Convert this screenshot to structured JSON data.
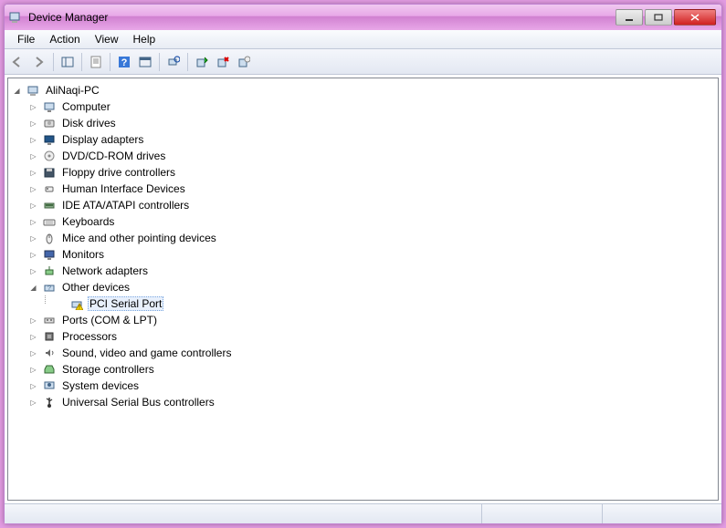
{
  "title": "Device Manager",
  "menu": {
    "file": "File",
    "action": "Action",
    "view": "View",
    "help": "Help"
  },
  "tree": {
    "root": "AliNaqi-PC",
    "items": [
      {
        "label": "Computer",
        "icon": "computer",
        "expanded": false
      },
      {
        "label": "Disk drives",
        "icon": "disk",
        "expanded": false
      },
      {
        "label": "Display adapters",
        "icon": "display",
        "expanded": false
      },
      {
        "label": "DVD/CD-ROM drives",
        "icon": "dvd",
        "expanded": false
      },
      {
        "label": "Floppy drive controllers",
        "icon": "floppy",
        "expanded": false
      },
      {
        "label": "Human Interface Devices",
        "icon": "hid",
        "expanded": false
      },
      {
        "label": "IDE ATA/ATAPI controllers",
        "icon": "ide",
        "expanded": false
      },
      {
        "label": "Keyboards",
        "icon": "keyboard",
        "expanded": false
      },
      {
        "label": "Mice and other pointing devices",
        "icon": "mouse",
        "expanded": false
      },
      {
        "label": "Monitors",
        "icon": "monitor",
        "expanded": false
      },
      {
        "label": "Network adapters",
        "icon": "network",
        "expanded": false
      },
      {
        "label": "Other devices",
        "icon": "other",
        "expanded": true,
        "children": [
          {
            "label": "PCI Serial Port",
            "icon": "warning",
            "selected": true
          }
        ]
      },
      {
        "label": "Ports (COM & LPT)",
        "icon": "port",
        "expanded": false
      },
      {
        "label": "Processors",
        "icon": "cpu",
        "expanded": false
      },
      {
        "label": "Sound, video and game controllers",
        "icon": "sound",
        "expanded": false
      },
      {
        "label": "Storage controllers",
        "icon": "storage",
        "expanded": false
      },
      {
        "label": "System devices",
        "icon": "system",
        "expanded": false
      },
      {
        "label": "Universal Serial Bus controllers",
        "icon": "usb",
        "expanded": false
      }
    ]
  }
}
